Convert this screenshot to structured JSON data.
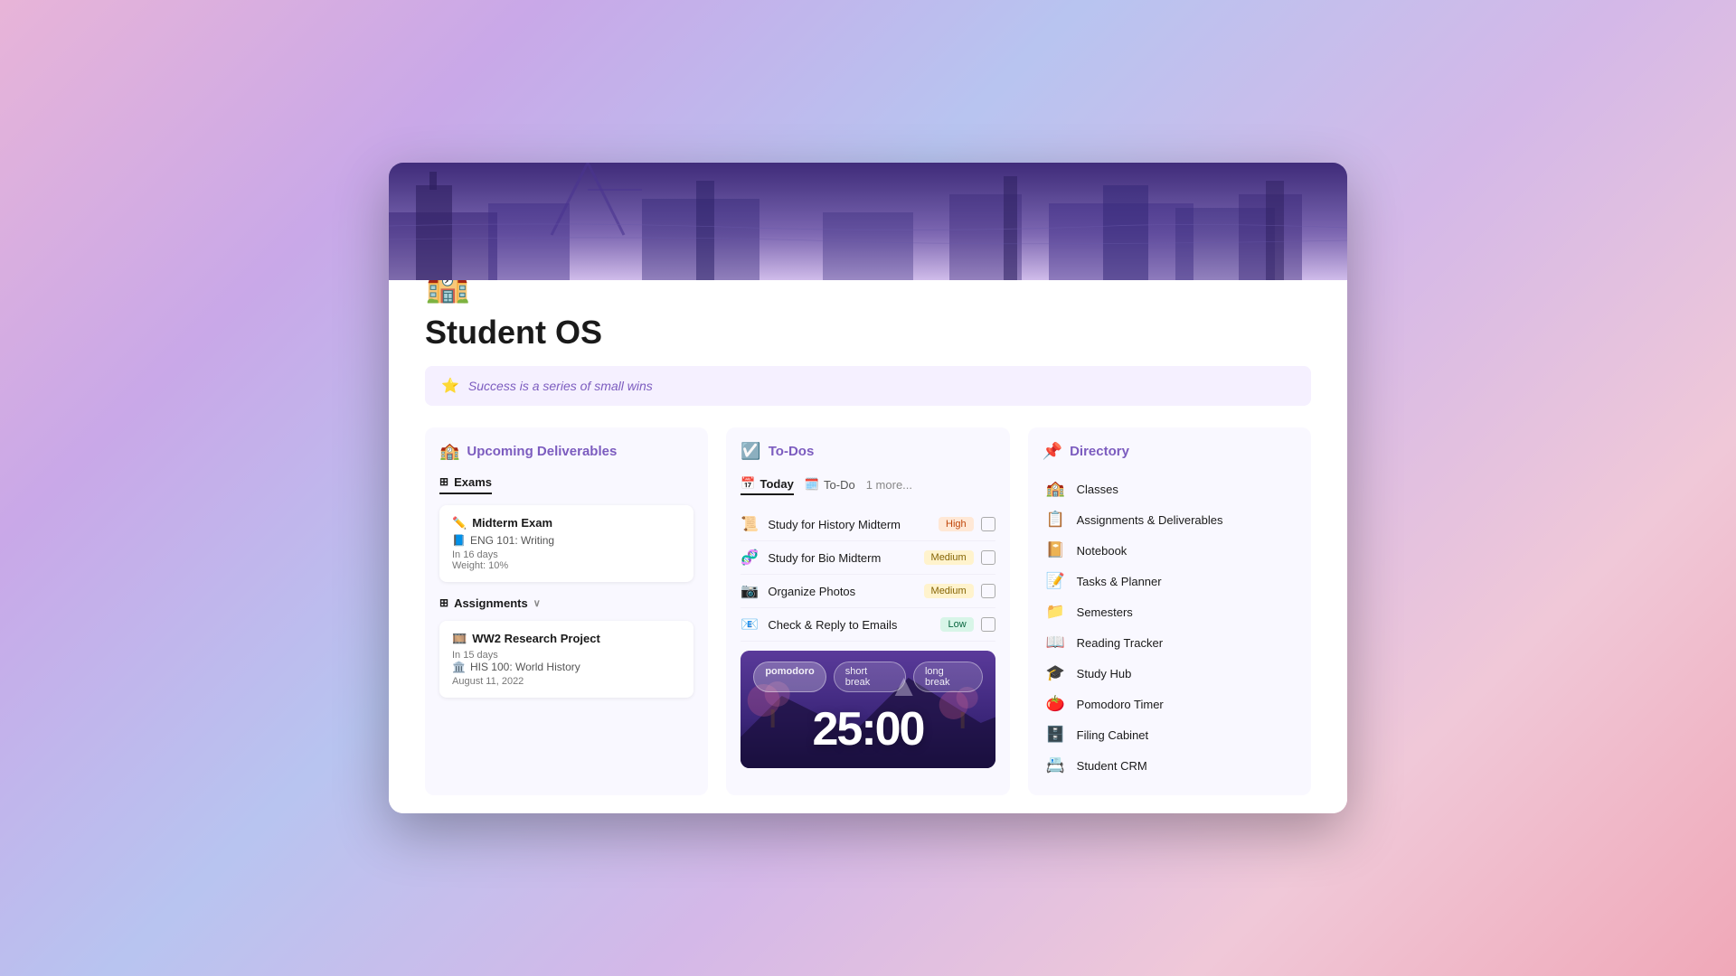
{
  "app": {
    "title": "Student OS",
    "icon": "🏫",
    "quote": "Success is a series of small wins",
    "quote_icon": "⭐"
  },
  "deliverables": {
    "section_title": "Upcoming Deliverables",
    "section_icon": "🏫",
    "exams_tab": "Exams",
    "exams_tab_icon": "⊞",
    "assignments_tab": "Assignments",
    "assignments_tab_icon": "⊞",
    "assignments_chevron": "∨",
    "exams": [
      {
        "icon": "✏️",
        "name": "Midterm Exam",
        "course_icon": "📘",
        "course": "ENG 101: Writing",
        "days": "In 16 days",
        "weight": "Weight: 10%"
      }
    ],
    "assignments": [
      {
        "icon": "🎞️",
        "name": "WW2 Research Project",
        "days": "In 15 days",
        "course_icon": "🏛️",
        "course": "HIS 100: World History",
        "date": "August 11, 2022"
      }
    ]
  },
  "todos": {
    "section_title": "To-Dos",
    "section_icon": "☑️",
    "tabs": [
      {
        "label": "Today",
        "icon": "📅",
        "active": true
      },
      {
        "label": "To-Do",
        "icon": "🗓️",
        "active": false
      },
      {
        "label": "1 more...",
        "active": false
      }
    ],
    "items": [
      {
        "icon": "📜",
        "text": "Study for History Midterm",
        "priority": "High",
        "priority_type": "high"
      },
      {
        "icon": "🧬",
        "text": "Study for Bio Midterm",
        "priority": "Medium",
        "priority_type": "medium"
      },
      {
        "icon": "📷",
        "text": "Organize Photos",
        "priority": "Medium",
        "priority_type": "medium"
      },
      {
        "icon": "📧",
        "text": "Check & Reply to Emails",
        "priority": "Low",
        "priority_type": "low"
      }
    ],
    "pomodoro": {
      "tabs": [
        "pomodoro",
        "short break",
        "long break"
      ],
      "active_tab": "pomodoro",
      "timer": "25:00"
    }
  },
  "directory": {
    "section_title": "Directory",
    "section_icon": "📌",
    "items": [
      {
        "icon": "🏫",
        "label": "Classes"
      },
      {
        "icon": "📋",
        "label": "Assignments & Deliverables"
      },
      {
        "icon": "📔",
        "label": "Notebook"
      },
      {
        "icon": "📝",
        "label": "Tasks & Planner"
      },
      {
        "icon": "📁",
        "label": "Semesters"
      },
      {
        "icon": "📖",
        "label": "Reading Tracker"
      },
      {
        "icon": "🎓",
        "label": "Study Hub"
      },
      {
        "icon": "🍅",
        "label": "Pomodoro Timer"
      },
      {
        "icon": "🗄️",
        "label": "Filing Cabinet"
      },
      {
        "icon": "📇",
        "label": "Student CRM"
      }
    ]
  }
}
